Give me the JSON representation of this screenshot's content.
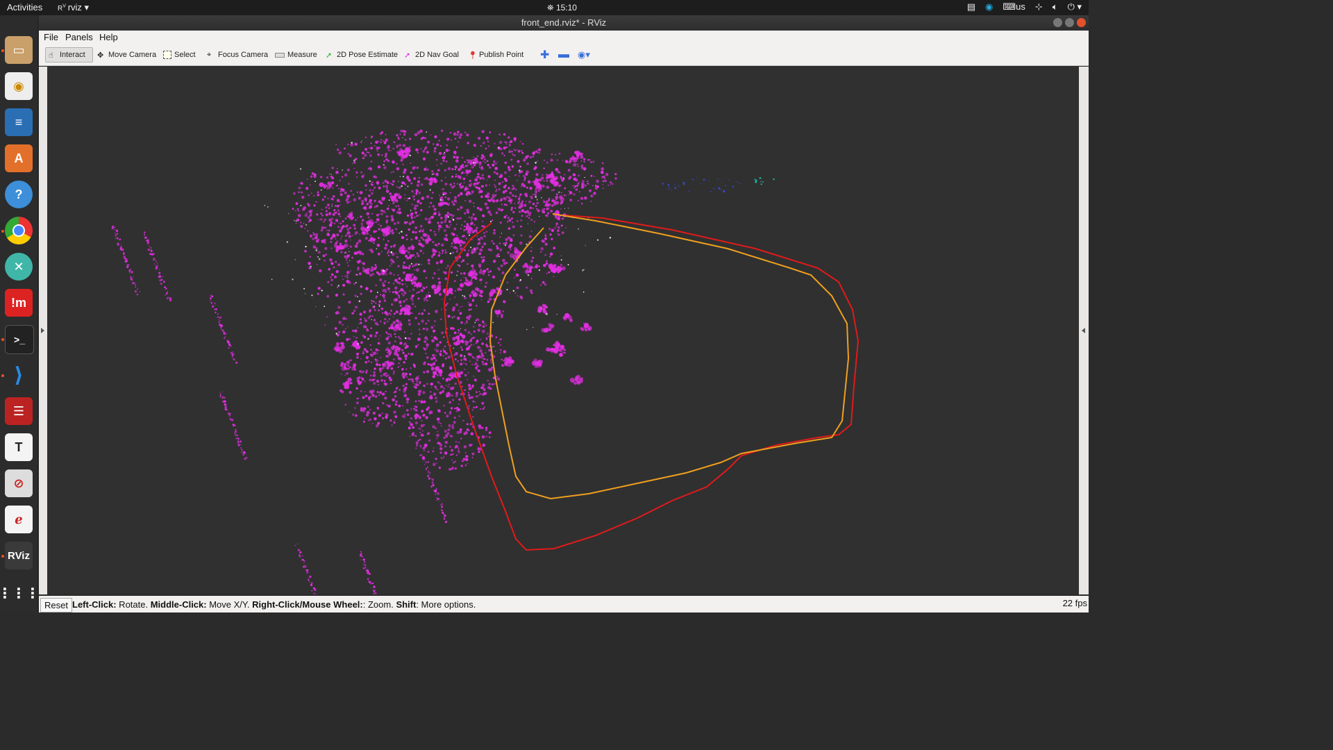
{
  "topbar": {
    "activities": "Activities",
    "app_name": "rviz",
    "clock": "15:10",
    "keyboard_layout": "us"
  },
  "window": {
    "title": "front_end.rviz* - RViz"
  },
  "menu": [
    {
      "label": "File"
    },
    {
      "label": "Panels"
    },
    {
      "label": "Help"
    }
  ],
  "toolbar": {
    "interact": "Interact",
    "move_camera": "Move Camera",
    "select": "Select",
    "focus_camera": "Focus Camera",
    "measure": "Measure",
    "pose_estimate": "2D Pose Estimate",
    "nav_goal": "2D Nav Goal",
    "publish_point": "Publish Point",
    "active_tool": "Interact"
  },
  "dock": {
    "icons": [
      "files-icon",
      "rhythmbox-icon",
      "writer-icon",
      "software-center-icon",
      "help-icon",
      "chrome-icon",
      "xmind-icon",
      "meteor-icon",
      "terminal-icon",
      "vscode-icon",
      "stack-icon",
      "typora-icon",
      "nosign-icon",
      "document-viewer-icon",
      "rviz-icon",
      "apps-grid-icon"
    ]
  },
  "viewport": {
    "background": "#303030",
    "pointcloud_color": "#e22ee2",
    "trajectory_colors": [
      "#e21a1a",
      "#f0a01e"
    ]
  },
  "status": {
    "reset": "Reset",
    "hint_b1": "Left-Click:",
    "hint_t1": " Rotate. ",
    "hint_b2": "Middle-Click:",
    "hint_t2": " Move X/Y. ",
    "hint_b3": "Right-Click/Mouse Wheel:",
    "hint_t3": ": Zoom. ",
    "hint_b4": "Shift",
    "hint_t4": ": More options.",
    "fps": "22 fps"
  }
}
